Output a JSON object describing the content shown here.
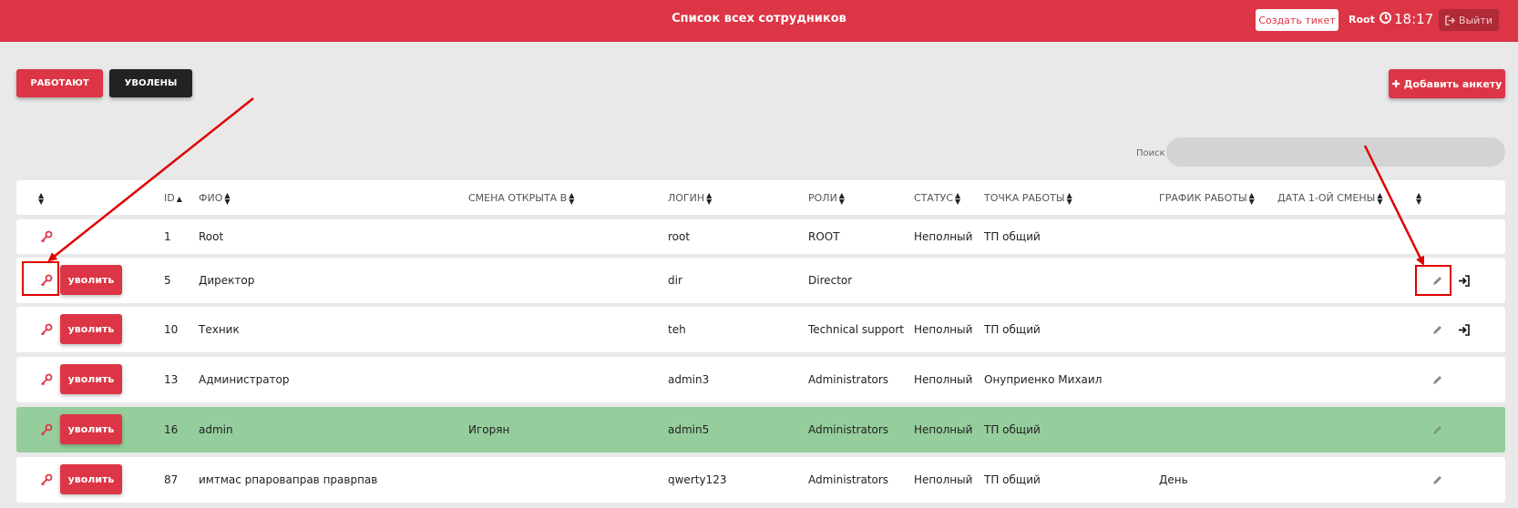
{
  "header": {
    "title": "Список всех сотрудников",
    "ticket_label": "Создать тикет",
    "user": "Root",
    "time": "18:17",
    "exit_label": "Выйти"
  },
  "filters": {
    "working": "РАБОТАЮТ",
    "fired": "УВОЛЕНЫ"
  },
  "add_label": "Добавить анкету",
  "search": {
    "label": "Поиск",
    "value": ""
  },
  "columns": {
    "id": "ID",
    "fio": "ФИО",
    "shift": "СМЕНА ОТКРЫТА В",
    "login": "ЛОГИН",
    "roles": "РОЛИ",
    "status": "СТАТУС",
    "point": "ТОЧКА РАБОТЫ",
    "schedule": "ГРАФИК РАБОТЫ",
    "first_shift": "ДАТА 1-ОЙ СМЕНЫ"
  },
  "fire_label": "уволить",
  "rows": [
    {
      "id": "1",
      "fio": "Root",
      "shift": "",
      "login": "root",
      "roles": "ROOT",
      "status": "Неполный",
      "point": "ТП общий",
      "schedule": ""
    },
    {
      "id": "5",
      "fio": "Директор",
      "shift": "",
      "login": "dir",
      "roles": "Director",
      "status": "",
      "point": "",
      "schedule": ""
    },
    {
      "id": "10",
      "fio": "Техник",
      "shift": "",
      "login": "teh",
      "roles": "Technical support",
      "status": "Неполный",
      "point": "ТП общий",
      "schedule": ""
    },
    {
      "id": "13",
      "fio": "Администратор",
      "shift": "",
      "login": "admin3",
      "roles": "Administrators",
      "status": "Неполный",
      "point": "Онуприенко Михаил",
      "schedule": ""
    },
    {
      "id": "16",
      "fio": "admin",
      "shift": "Игорян",
      "login": "admin5",
      "roles": "Administrators",
      "status": "Неполный",
      "point": "ТП общий",
      "schedule": ""
    },
    {
      "id": "87",
      "fio": "имтмас рпароваправ правpпав",
      "shift": "",
      "login": "qwerty123",
      "roles": "Administrators",
      "status": "Неполный",
      "point": "ТП общий",
      "schedule": "День"
    }
  ],
  "colors": {
    "accent": "#dc3545",
    "highlight_row": "#95cd9c",
    "annotation": "#e10000"
  }
}
